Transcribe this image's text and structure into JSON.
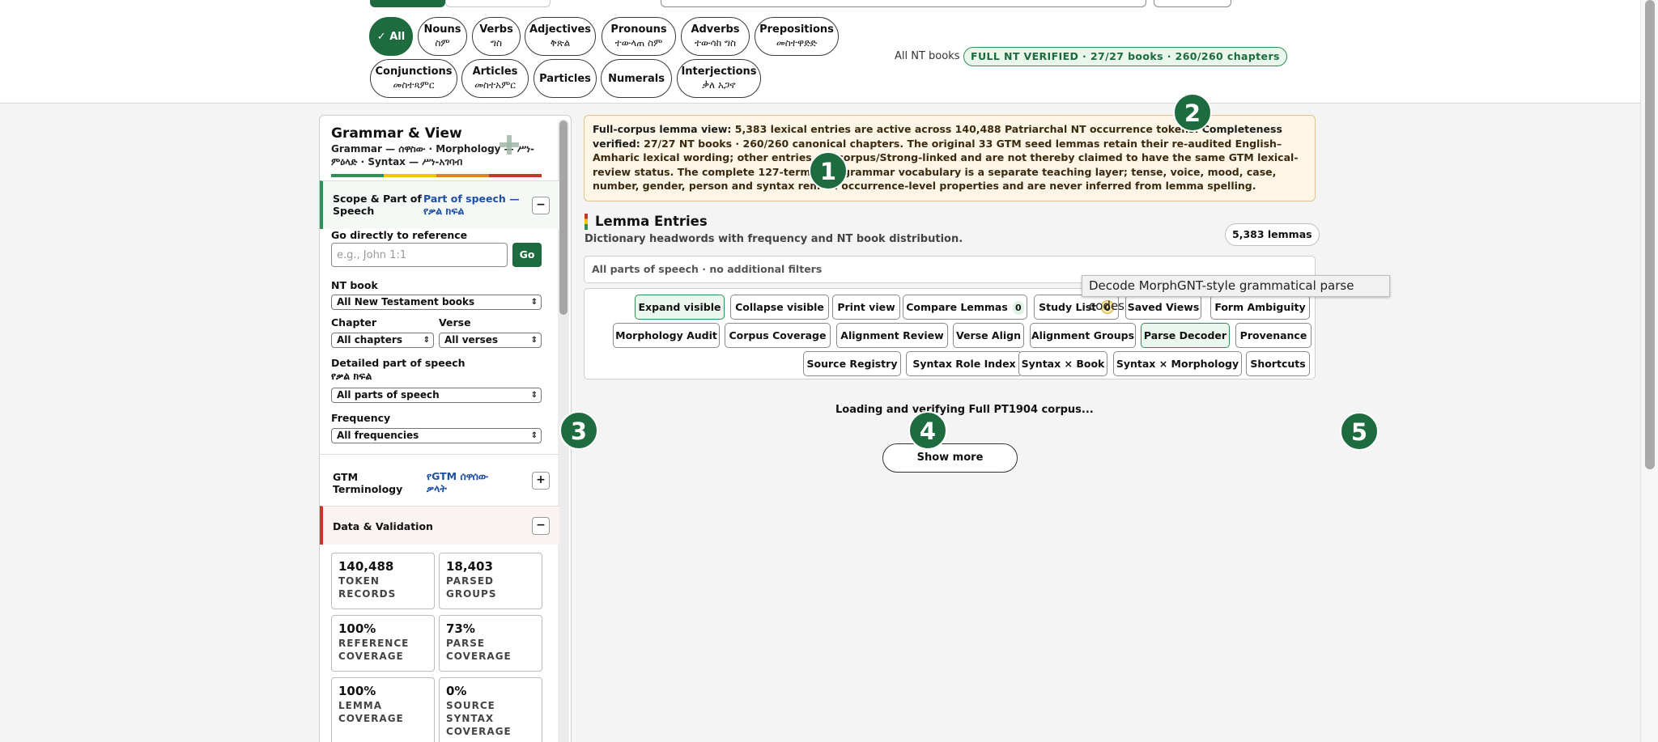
{
  "filters": {
    "pos_pills": [
      {
        "label": "✓ All",
        "sub": "",
        "active": true
      },
      {
        "label": "Nouns",
        "sub": "ስም"
      },
      {
        "label": "Verbs",
        "sub": "ግስ"
      },
      {
        "label": "Adjectives",
        "sub": "ቅጽል"
      },
      {
        "label": "Pronouns",
        "sub": "ተውላጠ ስም"
      },
      {
        "label": "Adverbs",
        "sub": "ተውሳከ ግስ"
      },
      {
        "label": "Prepositions",
        "sub": "መስተዋድድ"
      },
      {
        "label": "Conjunctions",
        "sub": "መስተጻምር"
      },
      {
        "label": "Articles",
        "sub": "መስተአምር"
      },
      {
        "label": "Particles",
        "sub": ""
      },
      {
        "label": "Numerals",
        "sub": ""
      },
      {
        "label": "Interjections",
        "sub": "ቃለ አጋኖ"
      }
    ],
    "books_label": "All NT books",
    "verified_badge": "FULL NT VERIFIED · 27/27 books · 260/260 chapters"
  },
  "sidebar": {
    "title": "Grammar & View",
    "subtitle": "Grammar — ሰዋስው · Morphology — ሥነ-ምዕላድ · Syntax — ሥነ-አገባብ",
    "scope_section": {
      "title": "Scope & Part of Speech",
      "sub": "Part of speech — የቃል ክፍል",
      "toggle": "−"
    },
    "goto_label": "Go directly to reference",
    "goto_placeholder": "e.g., John 1:1",
    "go_button": "Go",
    "nt_book_label": "NT book",
    "nt_book_value": "All New Testament books",
    "chapter_label": "Chapter",
    "chapter_value": "All chapters",
    "verse_label": "Verse",
    "verse_value": "All verses",
    "detailed_pos_label": "Detailed part of speech",
    "detailed_pos_sub": "የቃል ክፍል",
    "detailed_pos_value": "All parts of speech",
    "frequency_label": "Frequency",
    "frequency_value": "All frequencies",
    "gtm_section": {
      "title": "GTM Terminology",
      "sub": "የGTM ሰዋሰው ቃላት",
      "toggle": "+"
    },
    "data_section": {
      "title": "Data & Validation",
      "toggle": "−"
    },
    "stats": [
      {
        "value": "140,488",
        "caption": "TOKEN RECORDS"
      },
      {
        "value": "18,403",
        "caption": "PARSED GROUPS"
      },
      {
        "value": "100%",
        "caption": "REFERENCE COVERAGE"
      },
      {
        "value": "73%",
        "caption": "PARSE COVERAGE"
      },
      {
        "value": "100%",
        "caption": "LEMMA COVERAGE"
      },
      {
        "value": "0%",
        "caption": "SOURCE SYNTAX COVERAGE"
      }
    ]
  },
  "notice": {
    "lead1": "Full-corpus lemma view:",
    "text1": " 5,383 lexical entries are active across 140,488 Patriarchal NT occurrence tokens. ",
    "lead2": "Completeness verified:",
    "text2": " 27/27 NT books · 260/260 canonical chapters. The original 33 GTM seed lemmas retain their re-audited English–Amharic lexical wording; other entries are corpus/Strong-linked and are not thereby claimed to have the same GTM lexical-review status. The complete 127-term GTM grammar vocabulary is a separate teaching layer; tense, voice, mood, case, number, gender, person and syntax remain occurrence-level properties and are never inferred from lemma spelling."
  },
  "lemma": {
    "title": "Lemma Entries",
    "subtitle": "Dictionary headwords with frequency and NT book distribution.",
    "count": "5,383 lemmas",
    "filter_summary": "All parts of speech · no additional filters"
  },
  "toolbar": {
    "rows": [
      [
        {
          "label": "Expand visible",
          "style": "green"
        },
        {
          "label": "Collapse visible"
        },
        {
          "label": "Print view"
        },
        {
          "label": "Compare Lemmas",
          "count": "0"
        },
        {
          "label": "Study List",
          "count": "0",
          "count_style": "yellow"
        },
        {
          "label": "Saved Views"
        },
        {
          "label": "Form Ambiguity"
        }
      ],
      [
        {
          "label": "Morphology Audit"
        },
        {
          "label": "Corpus Coverage"
        },
        {
          "label": "Alignment Review"
        },
        {
          "label": "Verse Align"
        },
        {
          "label": "Alignment Groups"
        },
        {
          "label": "Parse Decoder",
          "style": "green"
        },
        {
          "label": "Provenance"
        }
      ],
      [
        {
          "label": "Source Registry"
        },
        {
          "label": "Syntax Role Index"
        },
        {
          "label": "Syntax × Book"
        },
        {
          "label": "Syntax × Morphology"
        },
        {
          "label": "Shortcuts"
        }
      ]
    ]
  },
  "tooltip": "Decode MorphGNT-style grammatical parse codes",
  "loading_text": "Loading and verifying Full PT1904 corpus...",
  "show_more": "Show more",
  "markers": [
    "1",
    "2",
    "3",
    "4",
    "5"
  ],
  "colors": {
    "accent_green": "#1d6b3e",
    "rainbow": [
      "#2f8f57",
      "#f1c40f",
      "#e67e22",
      "#c0392b"
    ]
  }
}
